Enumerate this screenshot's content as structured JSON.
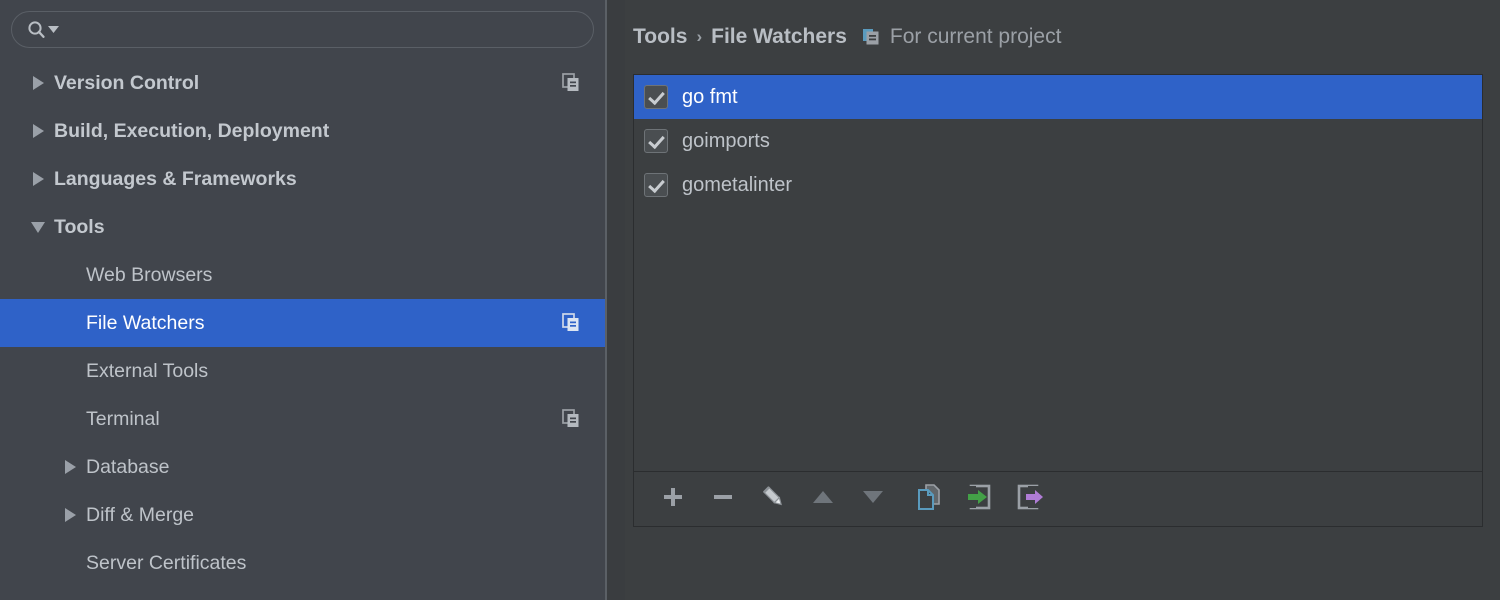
{
  "theme": {
    "sidebar_bg": "#41454c",
    "panel_bg": "#3c3f41",
    "selection_blue": "#2f62c8",
    "text": "#bec3c9",
    "text_dim": "#9ba0a6",
    "border": "#2b2d2f",
    "import_green": "#43a047",
    "export_purple": "#b07cd6",
    "copy_blue": "#5a9bbe"
  },
  "sidebar": {
    "search": {
      "value": "",
      "placeholder": "",
      "icon": "search-icon",
      "dropdown_icon": "chevron-down-icon"
    },
    "items": [
      {
        "label": "Version Control",
        "level": 0,
        "bold": true,
        "twisty": "collapsed",
        "selected": false,
        "badge": "copy-to-projects-icon"
      },
      {
        "label": "Build, Execution, Deployment",
        "level": 0,
        "bold": true,
        "twisty": "collapsed",
        "selected": false,
        "badge": null
      },
      {
        "label": "Languages & Frameworks",
        "level": 0,
        "bold": true,
        "twisty": "collapsed",
        "selected": false,
        "badge": null
      },
      {
        "label": "Tools",
        "level": 0,
        "bold": true,
        "twisty": "expanded",
        "selected": false,
        "badge": null
      },
      {
        "label": "Web Browsers",
        "level": 1,
        "bold": false,
        "twisty": "none",
        "selected": false,
        "badge": null
      },
      {
        "label": "File Watchers",
        "level": 1,
        "bold": false,
        "twisty": "none",
        "selected": true,
        "badge": "copy-to-projects-icon"
      },
      {
        "label": "External Tools",
        "level": 1,
        "bold": false,
        "twisty": "none",
        "selected": false,
        "badge": null
      },
      {
        "label": "Terminal",
        "level": 1,
        "bold": false,
        "twisty": "none",
        "selected": false,
        "badge": "copy-to-projects-icon"
      },
      {
        "label": "Database",
        "level": 1,
        "bold": false,
        "twisty": "collapsed",
        "selected": false,
        "badge": null
      },
      {
        "label": "Diff & Merge",
        "level": 1,
        "bold": false,
        "twisty": "collapsed",
        "selected": false,
        "badge": null
      },
      {
        "label": "Server Certificates",
        "level": 1,
        "bold": false,
        "twisty": "none",
        "selected": false,
        "badge": null
      }
    ]
  },
  "main": {
    "breadcrumb": {
      "parent": "Tools",
      "separator": "›",
      "current": "File Watchers",
      "scope_icon": "copy-to-projects-icon",
      "scope_label": "For current project"
    },
    "watchers": [
      {
        "name": "go fmt",
        "checked": true,
        "selected": true
      },
      {
        "name": "goimports",
        "checked": true,
        "selected": false
      },
      {
        "name": "gometalinter",
        "checked": true,
        "selected": false
      }
    ],
    "toolbar": [
      {
        "name": "add-button",
        "icon": "plus-icon",
        "label": "Add"
      },
      {
        "name": "remove-button",
        "icon": "minus-icon",
        "label": "Remove"
      },
      {
        "name": "edit-button",
        "icon": "pencil-icon",
        "label": "Edit"
      },
      {
        "name": "move-up-button",
        "icon": "arrow-up-icon",
        "label": "Move Up"
      },
      {
        "name": "move-down-button",
        "icon": "arrow-down-icon",
        "label": "Move Down"
      },
      {
        "name": "copy-button",
        "icon": "copy-pages-icon",
        "label": "Copy"
      },
      {
        "name": "import-button",
        "icon": "import-icon",
        "label": "Import"
      },
      {
        "name": "export-button",
        "icon": "export-icon",
        "label": "Export"
      }
    ]
  }
}
